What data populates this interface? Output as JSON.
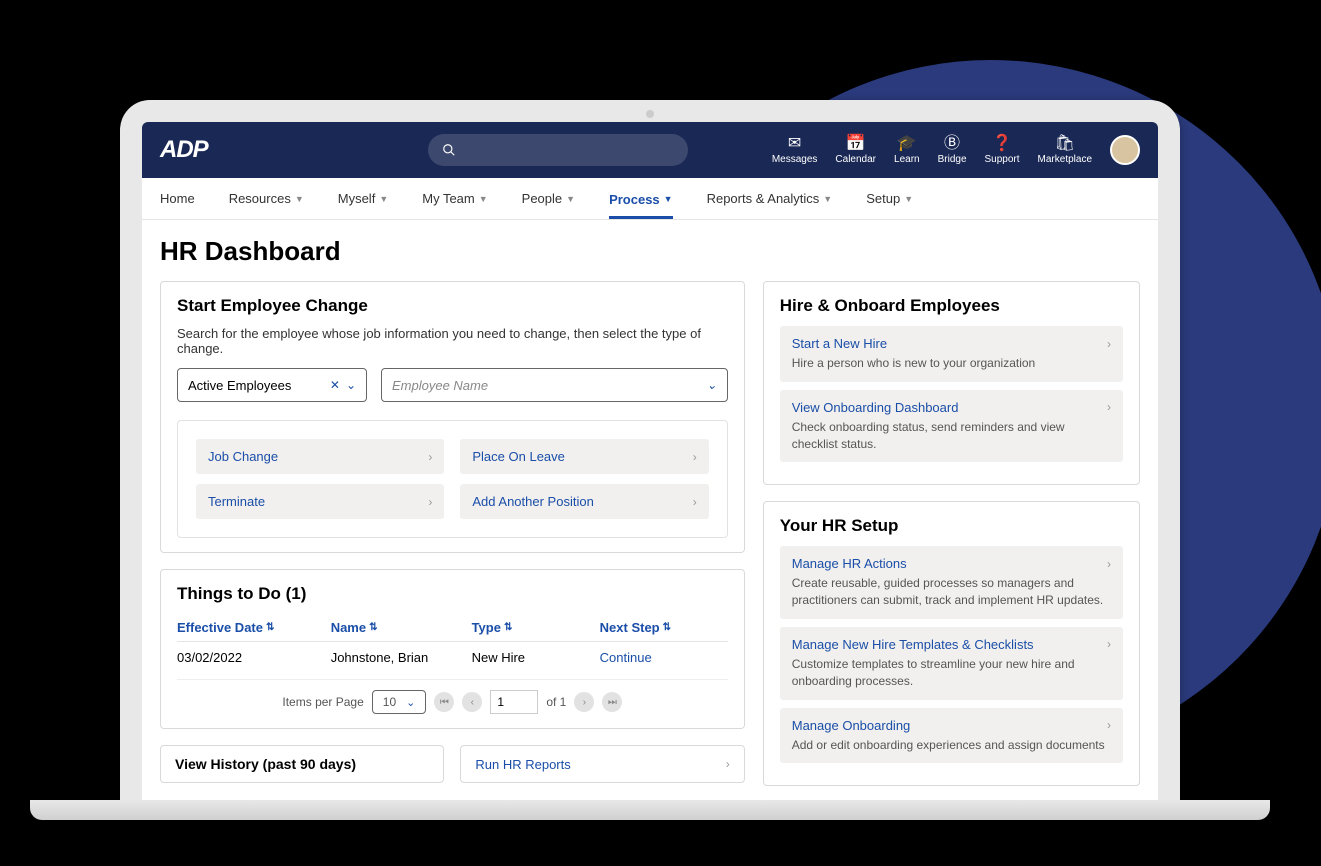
{
  "brand": "ADP",
  "topIcons": [
    {
      "label": "Messages",
      "glyph": "✉"
    },
    {
      "label": "Calendar",
      "glyph": "📅"
    },
    {
      "label": "Learn",
      "glyph": "🎓"
    },
    {
      "label": "Bridge",
      "glyph": "Ⓑ"
    },
    {
      "label": "Support",
      "glyph": "❓"
    },
    {
      "label": "Marketplace",
      "glyph": "🛍"
    }
  ],
  "menu": [
    {
      "label": "Home",
      "dropdown": false
    },
    {
      "label": "Resources",
      "dropdown": true
    },
    {
      "label": "Myself",
      "dropdown": true
    },
    {
      "label": "My Team",
      "dropdown": true
    },
    {
      "label": "People",
      "dropdown": true
    },
    {
      "label": "Process",
      "dropdown": true,
      "active": true
    },
    {
      "label": "Reports & Analytics",
      "dropdown": true
    },
    {
      "label": "Setup",
      "dropdown": true
    }
  ],
  "pageTitle": "HR Dashboard",
  "startChange": {
    "title": "Start Employee Change",
    "help": "Search for the employee whose job information you need to change, then select the type of change.",
    "filterLabel": "Active Employees",
    "namePlaceholder": "Employee Name",
    "actions": [
      "Job Change",
      "Place On Leave",
      "Terminate",
      "Add Another Position"
    ]
  },
  "todo": {
    "title": "Things to Do (1)",
    "columns": [
      "Effective Date",
      "Name",
      "Type",
      "Next Step"
    ],
    "rows": [
      {
        "date": "03/02/2022",
        "name": "Johnstone, Brian",
        "type": "New Hire",
        "next": "Continue"
      }
    ],
    "pager": {
      "itemsLabel": "Items per Page",
      "perPage": "10",
      "page": "1",
      "ofLabel": "of 1"
    }
  },
  "hire": {
    "title": "Hire & Onboard Employees",
    "items": [
      {
        "title": "Start a New Hire",
        "desc": "Hire a person who is new to your organization"
      },
      {
        "title": "View Onboarding Dashboard",
        "desc": "Check onboarding status, send reminders and view checklist status."
      }
    ]
  },
  "setup": {
    "title": "Your HR Setup",
    "items": [
      {
        "title": "Manage HR Actions",
        "desc": "Create reusable, guided processes so managers and practitioners can submit, track and implement HR updates."
      },
      {
        "title": "Manage New Hire Templates & Checklists",
        "desc": "Customize templates to streamline your new hire and onboarding processes."
      },
      {
        "title": "Manage Onboarding",
        "desc": "Add or edit onboarding experiences and assign documents"
      }
    ]
  },
  "bottom": {
    "history": "View History (past 90 days)",
    "reports": "Run HR Reports"
  }
}
